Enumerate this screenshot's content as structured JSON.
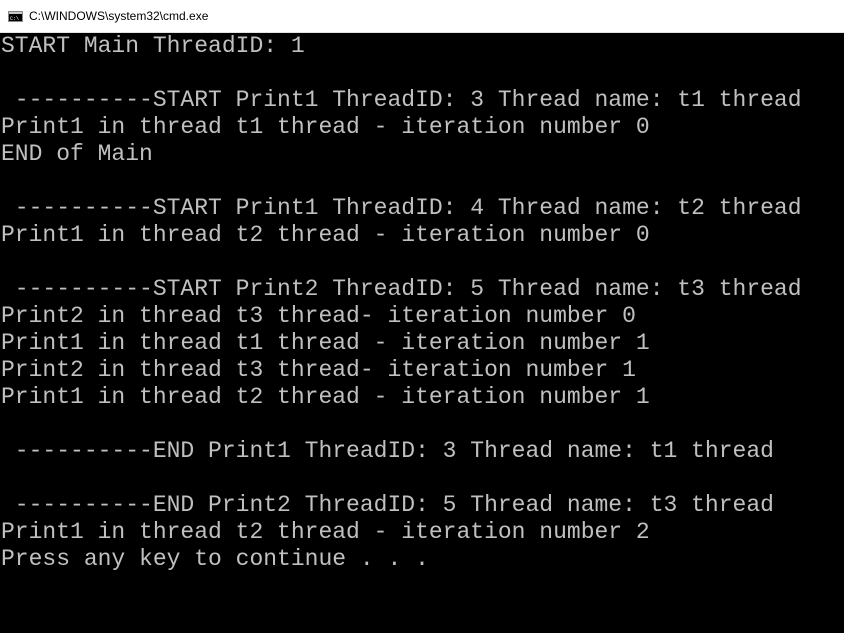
{
  "window": {
    "title": "C:\\WINDOWS\\system32\\cmd.exe",
    "icon": "cmd-icon",
    "background_color": "#000000",
    "text_color": "#c0c0c0"
  },
  "console": {
    "lines": [
      "START Main ThreadID: 1",
      "",
      " ----------START Print1 ThreadID: 3 Thread name: t1 thread",
      "Print1 in thread t1 thread - iteration number 0",
      "END of Main",
      "",
      " ----------START Print1 ThreadID: 4 Thread name: t2 thread",
      "Print1 in thread t2 thread - iteration number 0",
      "",
      " ----------START Print2 ThreadID: 5 Thread name: t3 thread",
      "Print2 in thread t3 thread- iteration number 0",
      "Print1 in thread t1 thread - iteration number 1",
      "Print2 in thread t3 thread- iteration number 1",
      "Print1 in thread t2 thread - iteration number 1",
      "",
      " ----------END Print1 ThreadID: 3 Thread name: t1 thread",
      "",
      " ----------END Print2 ThreadID: 5 Thread name: t3 thread",
      "Print1 in thread t2 thread - iteration number 2",
      "Press any key to continue . . ."
    ]
  }
}
